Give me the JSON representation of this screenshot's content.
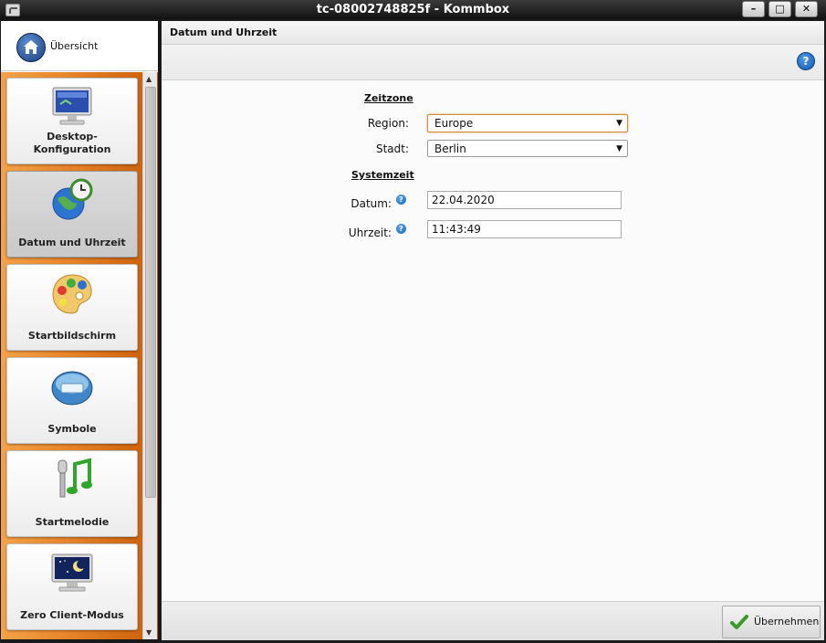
{
  "window": {
    "title": "tc-08002748825f - Kommbox",
    "minimize": "–",
    "maximize": "□",
    "close": "✕"
  },
  "sidebar": {
    "overview_label": "Übersicht",
    "items": [
      {
        "label": "Desktop-\nKonfiguration",
        "icon": "monitor-icon",
        "active": false
      },
      {
        "label": "Datum und Uhrzeit",
        "icon": "globe-clock-icon",
        "active": true
      },
      {
        "label": "Startbildschirm",
        "icon": "palette-icon",
        "active": false
      },
      {
        "label": "Symbole",
        "icon": "icons-badge-icon",
        "active": false
      },
      {
        "label": "Startmelodie",
        "icon": "microphone-note-icon",
        "active": false
      },
      {
        "label": "Zero Client-Modus",
        "icon": "night-monitor-icon",
        "active": false
      }
    ]
  },
  "main": {
    "header_title": "Datum und Uhrzeit",
    "timezone_heading": "Zeitzone",
    "region_label": "Region:",
    "region_value": "Europe",
    "city_label": "Stadt:",
    "city_value": "Berlin",
    "systemtime_heading": "Systemzeit",
    "date_label": "Datum:",
    "date_value": "22.04.2020",
    "time_label": "Uhrzeit:",
    "time_value": "11:43:49",
    "apply_label": "Übernehmen"
  },
  "colors": {
    "sidebar_orange": "#e9862b",
    "focus_border": "#d08f3a",
    "help_blue": "#1555b0"
  }
}
